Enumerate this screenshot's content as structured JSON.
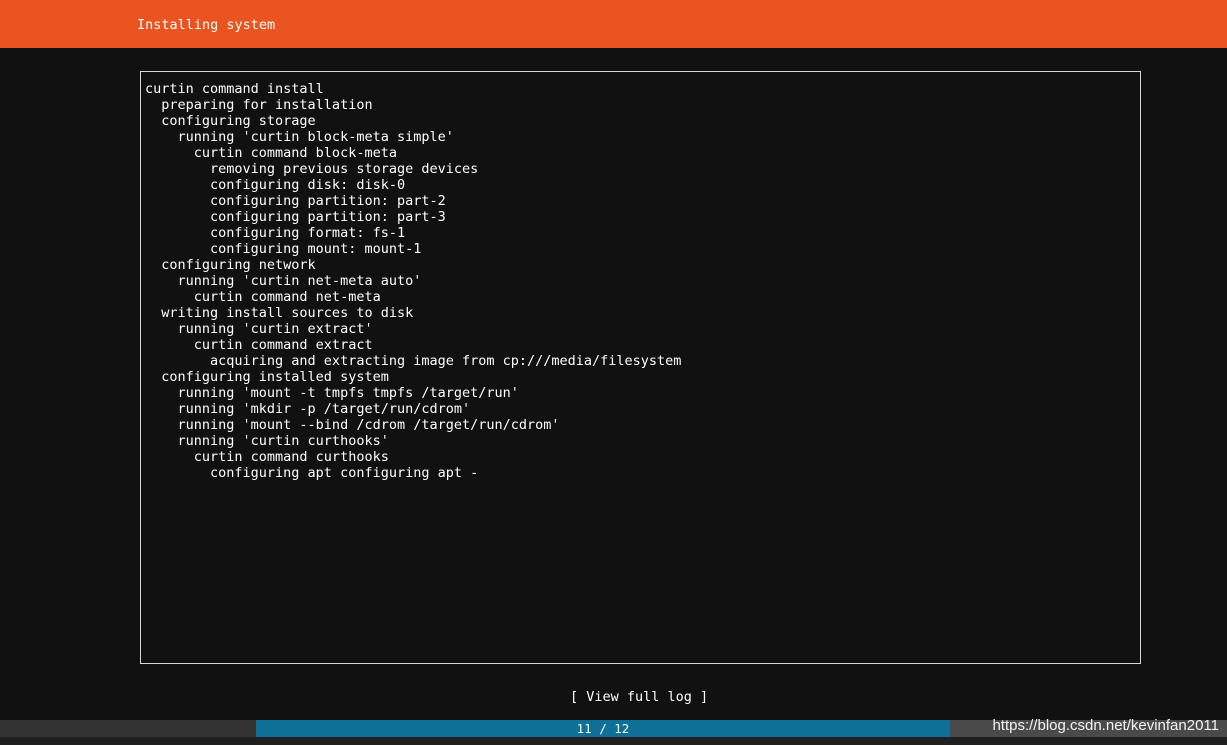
{
  "header": {
    "title": "Installing system",
    "accent_color": "#e95420"
  },
  "log": {
    "lines": [
      "curtin command install",
      "  preparing for installation",
      "  configuring storage",
      "    running 'curtin block-meta simple'",
      "      curtin command block-meta",
      "        removing previous storage devices",
      "        configuring disk: disk-0",
      "        configuring partition: part-2",
      "        configuring partition: part-3",
      "        configuring format: fs-1",
      "        configuring mount: mount-1",
      "  configuring network",
      "    running 'curtin net-meta auto'",
      "      curtin command net-meta",
      "  writing install sources to disk",
      "    running 'curtin extract'",
      "      curtin command extract",
      "        acquiring and extracting image from cp:///media/filesystem",
      "  configuring installed system",
      "    running 'mount -t tmpfs tmpfs /target/run'",
      "    running 'mkdir -p /target/run/cdrom'",
      "    running 'mount --bind /cdrom /target/run/cdrom'",
      "    running 'curtin curthooks'",
      "      curtin command curthooks",
      "        configuring apt configuring apt -"
    ]
  },
  "actions": {
    "view_full_log_label": "[ View full log ]"
  },
  "progress": {
    "label": "11 / 12",
    "current": 11,
    "total": 12,
    "fill_color": "#0e6f97"
  },
  "watermark": {
    "text": "https://blog.csdn.net/kevinfan2011"
  }
}
